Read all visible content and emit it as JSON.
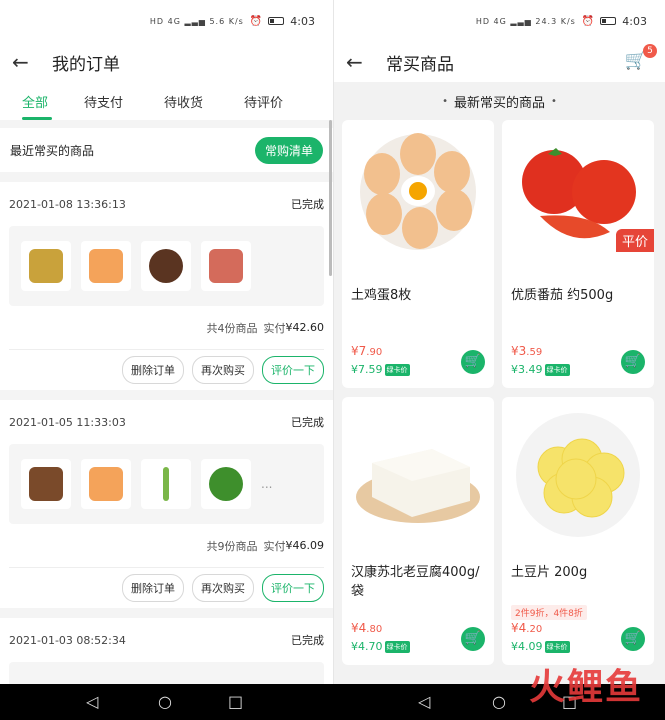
{
  "status": {
    "time": "4:03",
    "signal_left": "HD 4G ▂▃▅ 5.6 K/s",
    "signal_right": "HD 4G ▂▃▅ 24.3 K/s"
  },
  "orders_screen": {
    "title": "我的订单",
    "tabs": [
      "全部",
      "待支付",
      "待收货",
      "待评价"
    ],
    "recent_label": "最近常买的商品",
    "recent_button": "常购清单",
    "orders": [
      {
        "time": "2021-01-08 13:36:13",
        "status": "已完成",
        "count": "共4份商品",
        "paid_label": "实付",
        "paid": "¥42.60",
        "thumbs": [
          "#c9a23b",
          "#f4a35a",
          "#5a3421",
          "#d46b5b"
        ],
        "more": ""
      },
      {
        "time": "2021-01-05 11:33:03",
        "status": "已完成",
        "count": "共9份商品",
        "paid_label": "实付",
        "paid": "¥46.09",
        "thumbs": [
          "#7a4a2a",
          "#f4a35a",
          "#7ab648",
          "#3e8f2c"
        ],
        "more": "..."
      },
      {
        "time": "2021-01-03 08:52:34",
        "status": "已完成"
      }
    ],
    "buttons": {
      "delete": "删除订单",
      "rebuy": "再次购买",
      "review": "评价一下"
    }
  },
  "frequent_screen": {
    "title": "常买商品",
    "cart_count": "5",
    "section_title": "最新常买的商品",
    "products": [
      {
        "name": "土鸡蛋8枚",
        "price_big": "¥7",
        "price_small": ".90",
        "vip_price": "¥7.59",
        "vip_label": "绿卡价",
        "promo": "",
        "tag": "",
        "icon": "egg"
      },
      {
        "name": "优质番茄 约500g",
        "price_big": "¥3",
        "price_small": ".59",
        "vip_price": "¥3.49",
        "vip_label": "绿卡价",
        "promo": "",
        "tag": "平价",
        "icon": "tomato"
      },
      {
        "name": "汉康苏北老豆腐400g/袋",
        "price_big": "¥4",
        "price_small": ".80",
        "vip_price": "¥4.70",
        "vip_label": "绿卡价",
        "promo": "",
        "tag": "",
        "icon": "tofu"
      },
      {
        "name": "土豆片 200g",
        "price_big": "¥4",
        "price_small": ".20",
        "vip_price": "¥4.09",
        "vip_label": "绿卡价",
        "promo": "2件9折，4件8折",
        "tag": "",
        "icon": "potato"
      }
    ]
  },
  "watermark": "火鲤鱼",
  "colors": {
    "accent": "#1bb46a",
    "price": "#f05a4a"
  }
}
